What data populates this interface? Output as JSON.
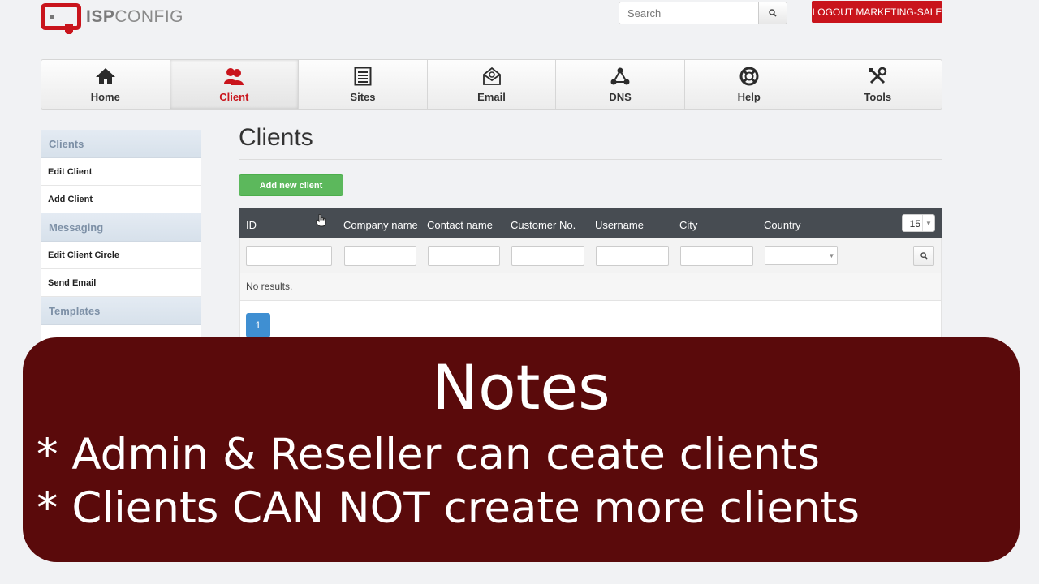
{
  "header": {
    "logo_bold": "ISP",
    "logo_light": "CONFIG",
    "search_placeholder": "Search",
    "logout_label": "LOGOUT MARKETING-SALE",
    "brand_color": "#c9141c"
  },
  "nav": [
    {
      "label": "Home",
      "icon": "home-icon"
    },
    {
      "label": "Client",
      "icon": "users-icon",
      "active": true
    },
    {
      "label": "Sites",
      "icon": "sites-icon"
    },
    {
      "label": "Email",
      "icon": "email-icon"
    },
    {
      "label": "DNS",
      "icon": "dns-icon"
    },
    {
      "label": "Help",
      "icon": "help-icon"
    },
    {
      "label": "Tools",
      "icon": "tools-icon"
    }
  ],
  "sidebar": {
    "sections": [
      {
        "title": "Clients",
        "items": [
          "Edit Client",
          "Add Client"
        ]
      },
      {
        "title": "Messaging",
        "items": [
          "Edit Client Circle",
          "Send Email"
        ]
      },
      {
        "title": "Templates",
        "items": []
      }
    ]
  },
  "main": {
    "title": "Clients",
    "add_button": "Add new client",
    "table": {
      "columns": [
        "ID",
        "Company name",
        "Contact name",
        "Customer No.",
        "Username",
        "City",
        "Country"
      ],
      "per_page": "15",
      "empty_text": "No results.",
      "current_page": "1"
    }
  },
  "notes": {
    "title": "Notes",
    "lines": [
      "* Admin & Reseller can ceate clients",
      "* Clients CAN NOT create more clients"
    ],
    "background": "#5a0a0b"
  }
}
